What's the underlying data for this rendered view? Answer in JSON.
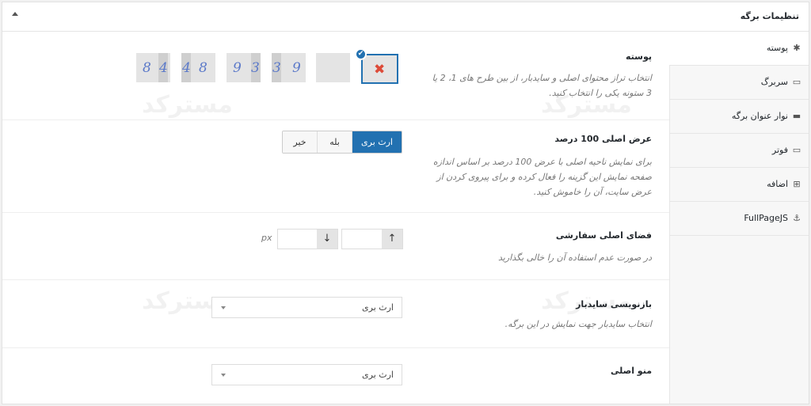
{
  "header": {
    "title": "تنظیمات برگه"
  },
  "tabs": [
    {
      "label": "پوسته",
      "icon": "wrench-icon",
      "glyph": "✱",
      "active": true
    },
    {
      "label": "سربرگ",
      "icon": "header-icon",
      "glyph": "▭",
      "active": false
    },
    {
      "label": "نوار عنوان برگه",
      "icon": "title-bar-icon",
      "glyph": "▬",
      "active": false
    },
    {
      "label": "فوتر",
      "icon": "footer-icon",
      "glyph": "▭",
      "active": false
    },
    {
      "label": "اضافه",
      "icon": "extra-icon",
      "glyph": "⊞",
      "active": false
    },
    {
      "label": "FullPageJS",
      "icon": "anchor-icon",
      "glyph": "⚓",
      "active": false
    }
  ],
  "layout": {
    "label": "پوسته",
    "description": "انتخاب تراز محتوای اصلی و سایدبار، از بین طرح های 1، 2 یا 3 ستونه یکی را انتخاب کنید.",
    "options": [
      {
        "digits": [
          "8",
          "4"
        ]
      },
      {
        "digits": [
          "4",
          "8"
        ]
      },
      {
        "digits": [
          "9",
          "3"
        ]
      },
      {
        "digits": [
          "3",
          "9"
        ]
      }
    ]
  },
  "fullwidth": {
    "label": "عرض اصلی 100 درصد",
    "description": "برای نمایش ناحیه اصلی با عرض 100 درصد بر اساس اندازه صفحه نمایش این گزینه را فعال کرده و برای پیروی کردن از عرض سایت، آن را خاموش کنید.",
    "options": [
      "ارث بری",
      "بله",
      "خیر"
    ],
    "selected": "ارث بری"
  },
  "spacing": {
    "label": "فضای اصلی سفارشی",
    "description": "در صورت عدم استفاده آن را خالی بگذارید",
    "top_value": "",
    "bottom_value": "",
    "unit": "px",
    "up_glyph": "↑",
    "down_glyph": "↓"
  },
  "sidebar": {
    "label": "بازنویسی سایدبار",
    "description": "انتخاب سایدبار جهت نمایش در این برگه.",
    "value": "ارث بری"
  },
  "menu": {
    "label": "منو اصلی",
    "value": "ارث بری"
  },
  "watermark": {
    "text": "مسترکد"
  },
  "colors": {
    "accent": "#2271b1",
    "delete": "#dd4b39",
    "layout_digit": "#5b79c9"
  }
}
